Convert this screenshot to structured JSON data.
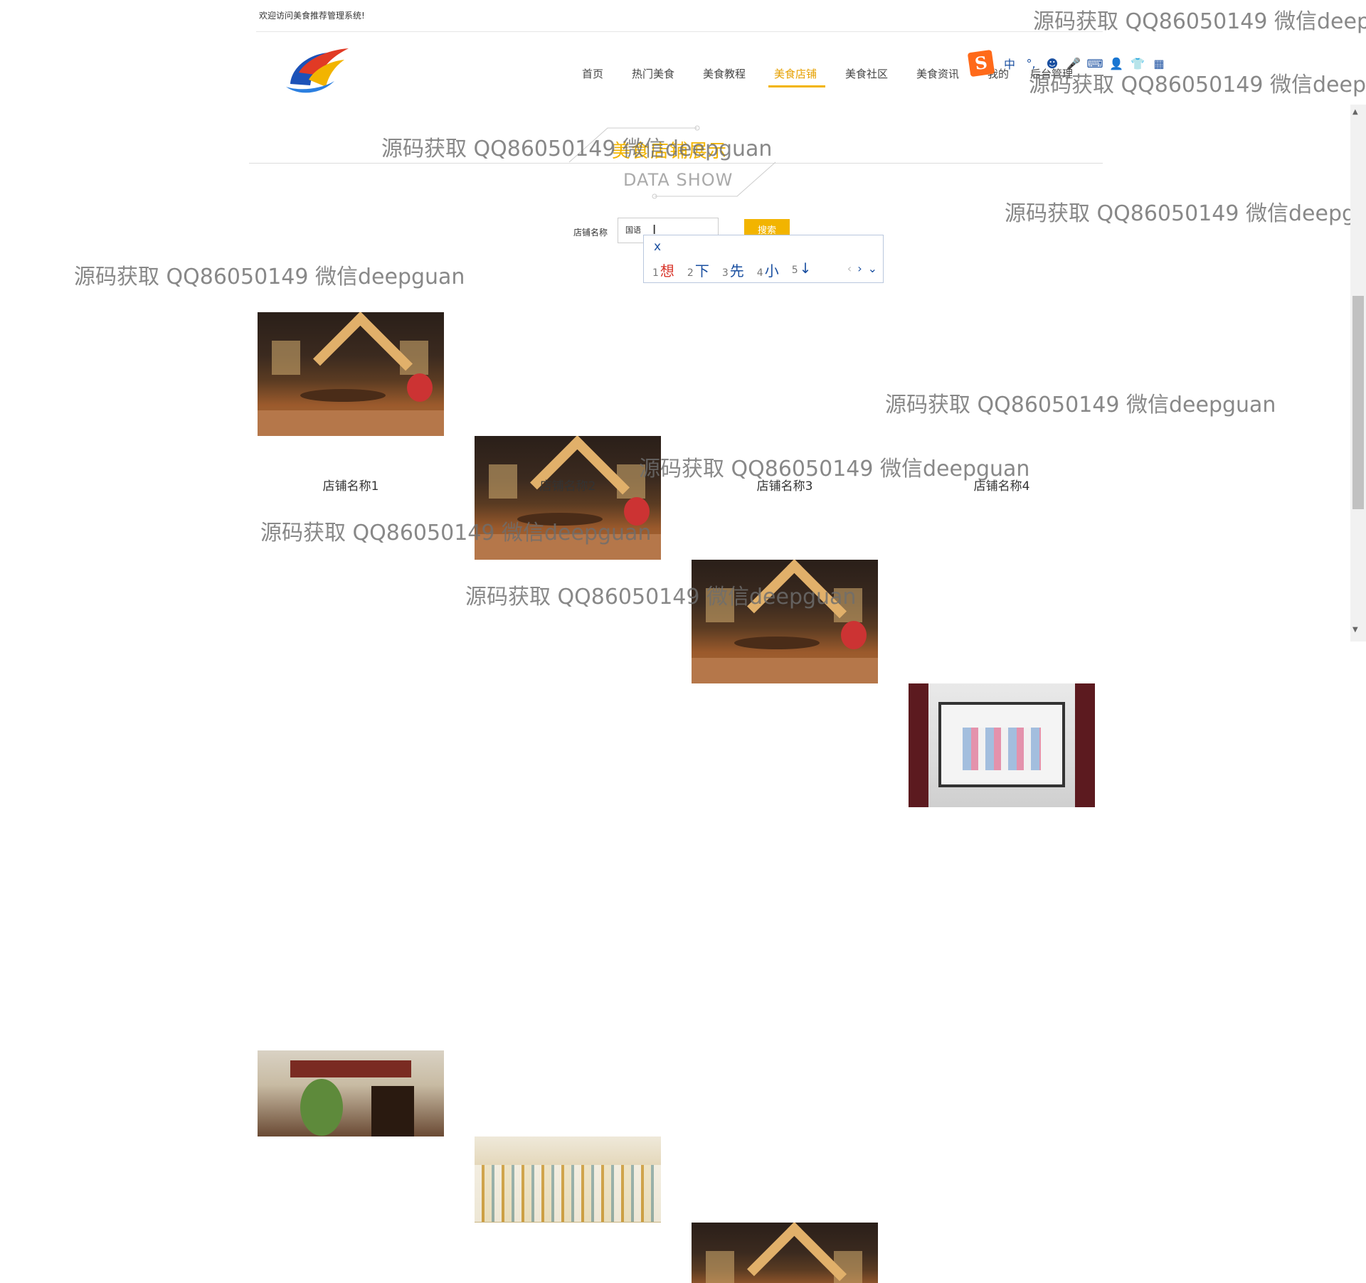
{
  "header": {
    "welcome": "欢迎访问美食推荐管理系统!"
  },
  "nav": {
    "items": [
      "首页",
      "热门美食",
      "美食教程",
      "美食店铺",
      "美食社区",
      "美食资讯",
      "我的",
      "后台管理"
    ],
    "active": "美食店铺"
  },
  "section": {
    "title": "美食店铺展示",
    "subtitle": "DATA SHOW"
  },
  "search": {
    "label": "店铺名称",
    "value": "国语",
    "button": "搜索"
  },
  "ime": {
    "composition": "x",
    "candidates": [
      {
        "num": "1",
        "text": "想"
      },
      {
        "num": "2",
        "text": "下"
      },
      {
        "num": "3",
        "text": "先"
      },
      {
        "num": "4",
        "text": "小"
      },
      {
        "num": "5",
        "text": "↓"
      }
    ],
    "prev": "‹",
    "next": "›",
    "more": "⌄",
    "toolbar": {
      "logo": "S",
      "lang": "中",
      "punct": "°,",
      "emoji": "☻",
      "voice": "🎤",
      "keyboard": "⌨",
      "user": "👤",
      "skin": "👕",
      "apps": "▦"
    }
  },
  "shops": [
    {
      "name": "店铺名称1",
      "image": "restaurant-interior"
    },
    {
      "name": "店铺名称2",
      "image": "restaurant-interior"
    },
    {
      "name": "店铺名称3",
      "image": "restaurant-interior"
    },
    {
      "name": "店铺名称4",
      "image": "shoe-store"
    },
    {
      "name": "",
      "image": "storefront"
    },
    {
      "name": "",
      "image": "market"
    },
    {
      "name": "",
      "image": "restaurant-interior"
    }
  ],
  "watermark": "源码获取 QQ86050149 微信deepguan",
  "scrollbar": {
    "up": "▲",
    "down": "▼"
  }
}
